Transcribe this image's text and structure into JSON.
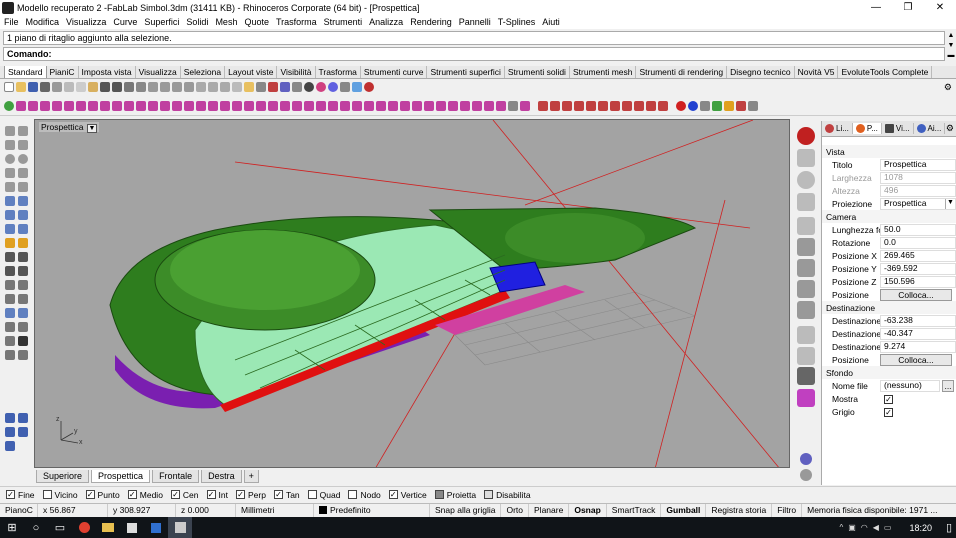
{
  "window": {
    "title": "Modello recuperato 2 -FabLab Simbol.3dm (31411 KB) - Rhinoceros Corporate (64 bit) - [Prospettica]",
    "minimize": "—",
    "restore": "❐",
    "close": "✕"
  },
  "menu": [
    "File",
    "Modifica",
    "Visualizza",
    "Curve",
    "Superfici",
    "Solidi",
    "Mesh",
    "Quote",
    "Trasforma",
    "Strumenti",
    "Analizza",
    "Rendering",
    "Pannelli",
    "T-Splines",
    "Aiuti"
  ],
  "command": {
    "history": "1 piano di ritaglio aggiunto alla selezione.",
    "label": "Comando:",
    "value": ""
  },
  "toolbar_tabs": [
    "Standard",
    "PianiC",
    "Imposta vista",
    "Visualizza",
    "Seleziona",
    "Layout viste",
    "Visibilità",
    "Trasforma",
    "Strumenti curve",
    "Strumenti superfici",
    "Strumenti solidi",
    "Strumenti mesh",
    "Strumenti di rendering",
    "Disegno tecnico",
    "Novità V5",
    "EvoluteTools Complete"
  ],
  "viewport": {
    "label": "Prospettica",
    "axis_x": "x",
    "axis_y": "y",
    "axis_z": "z",
    "tabs": [
      "Superiore",
      "Prospettica",
      "Frontale",
      "Destra"
    ],
    "active_tab": "Prospettica",
    "add_tab": "+"
  },
  "panel": {
    "tabs": [
      "Li...",
      "P...",
      "Vi...",
      "Ai..."
    ],
    "sections": {
      "vista": "Vista",
      "camera": "Camera",
      "destinazione": "Destinazione",
      "sfondo": "Sfondo"
    },
    "vista": {
      "titolo_k": "Titolo",
      "titolo_v": "Prospettica",
      "larghezza_k": "Larghezza",
      "larghezza_v": "1078",
      "altezza_k": "Altezza",
      "altezza_v": "496",
      "proiezione_k": "Proiezione",
      "proiezione_v": "Prospettica"
    },
    "camera": {
      "lf_k": "Lunghezza fo...",
      "lf_v": "50.0",
      "rot_k": "Rotazione",
      "rot_v": "0.0",
      "px_k": "Posizione X",
      "px_v": "269.465",
      "py_k": "Posizione Y",
      "py_v": "-369.592",
      "pz_k": "Posizione Z",
      "pz_v": "150.596",
      "pos_k": "Posizione",
      "pos_btn": "Colloca..."
    },
    "destinazione": {
      "dx_k": "Destinazione X",
      "dx_v": "-63.238",
      "dy_k": "Destinazione Y",
      "dy_v": "-40.347",
      "dz_k": "Destinazione Z",
      "dz_v": "9.274",
      "pos_k": "Posizione",
      "pos_btn": "Colloca..."
    },
    "sfondo": {
      "file_k": "Nome file",
      "file_v": "(nessuno)",
      "file_btn": "...",
      "mostra_k": "Mostra",
      "grigio_k": "Grigio"
    }
  },
  "osnap": [
    {
      "label": "Fine",
      "checked": true
    },
    {
      "label": "Vicino",
      "checked": false
    },
    {
      "label": "Punto",
      "checked": true
    },
    {
      "label": "Medio",
      "checked": true
    },
    {
      "label": "Cen",
      "checked": true
    },
    {
      "label": "Int",
      "checked": true
    },
    {
      "label": "Perp",
      "checked": true
    },
    {
      "label": "Tan",
      "checked": true
    },
    {
      "label": "Quad",
      "checked": false
    },
    {
      "label": "Nodo",
      "checked": false
    },
    {
      "label": "Vertice",
      "checked": true
    },
    {
      "label": "Proietta",
      "checked": false
    },
    {
      "label": "Disabilita",
      "checked": false
    }
  ],
  "status": {
    "cplane": "PianoC",
    "x": "x 56.867",
    "y": "y 308.927",
    "z": "z 0.000",
    "units": "Millimetri",
    "layer": "Predefinito",
    "grid_snap": "Snap alla griglia",
    "orto": "Orto",
    "planare": "Planare",
    "osnap": "Osnap",
    "smarttrack": "SmartTrack",
    "gumball": "Gumball",
    "history": "Registra storia",
    "filter": "Filtro",
    "memory": "Memoria fisica disponibile: 1971 ..."
  },
  "taskbar": {
    "time": "18:20"
  },
  "colors": {
    "viewport_bg": "#a3a3a3",
    "model_green": "#2e7d1e",
    "model_light": "#9be8b4",
    "edge_red": "#e01010",
    "purple": "#7a1fb0",
    "blue": "#2020e0"
  }
}
